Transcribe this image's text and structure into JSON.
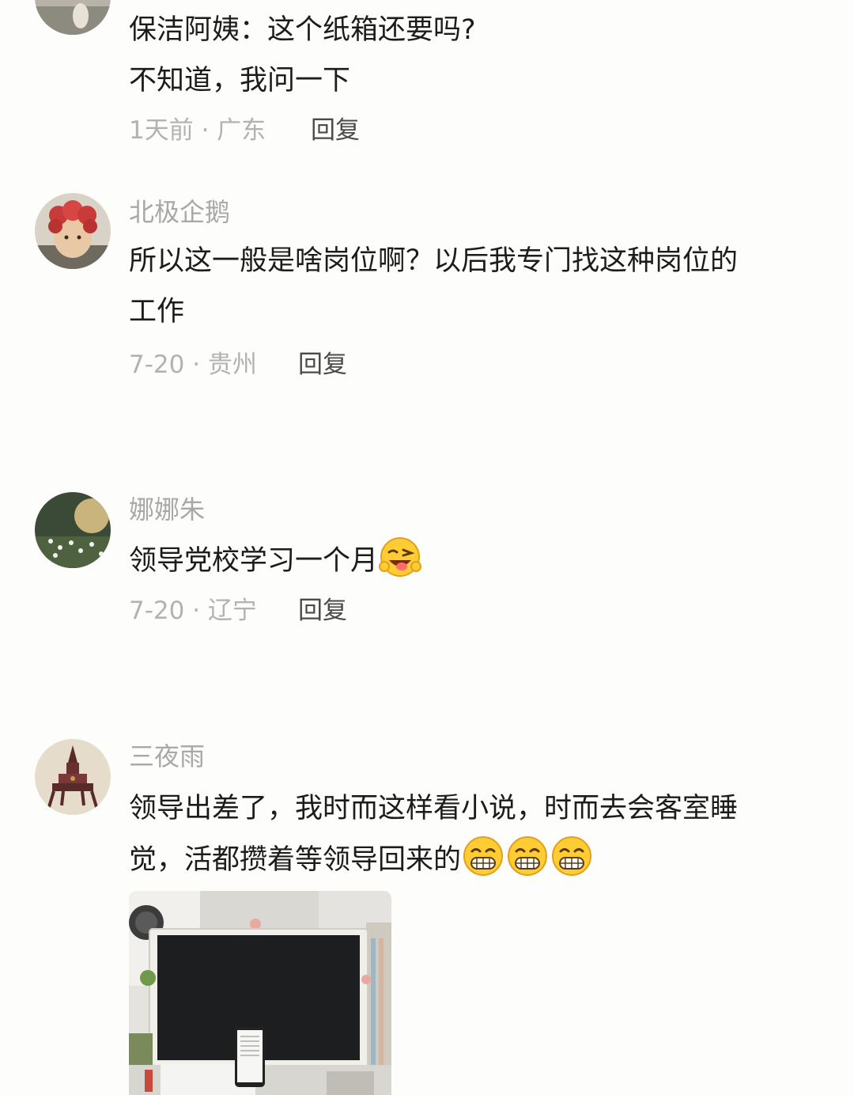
{
  "comments": [
    {
      "username": "",
      "lines": [
        "保洁阿姨：这个纸箱还要吗?",
        "不知道，我问一下"
      ],
      "time": "1天前",
      "location": "广东",
      "meta": "1天前 · 广东",
      "reply_label": "回复"
    },
    {
      "username": "北极企鹅",
      "lines": [
        "所以这一般是啥岗位啊？以后我专门找这种岗位的",
        "工作"
      ],
      "time": "7-20",
      "location": "贵州",
      "meta": "7-20 · 贵州",
      "reply_label": "回复"
    },
    {
      "username": "娜娜朱",
      "lines": [
        "领导党校学习一个月"
      ],
      "emoji": "wink-tongue-emoji",
      "time": "7-20",
      "location": "辽宁",
      "meta": "7-20 · 辽宁",
      "reply_label": "回复"
    },
    {
      "username": "三夜雨",
      "lines": [
        "领导出差了，我时而这样看小说，时而去会客室睡",
        "觉，活都攒着等领导回来的"
      ],
      "emoji": "grin-emoji",
      "emoji_count": 3,
      "attachment": "desk-photo"
    }
  ],
  "colors": {
    "background": "#fdfdfb",
    "username": "#a8a8a8",
    "text": "#1c1c1c",
    "meta": "#b2b2b2",
    "reply": "#4a4a4a"
  }
}
